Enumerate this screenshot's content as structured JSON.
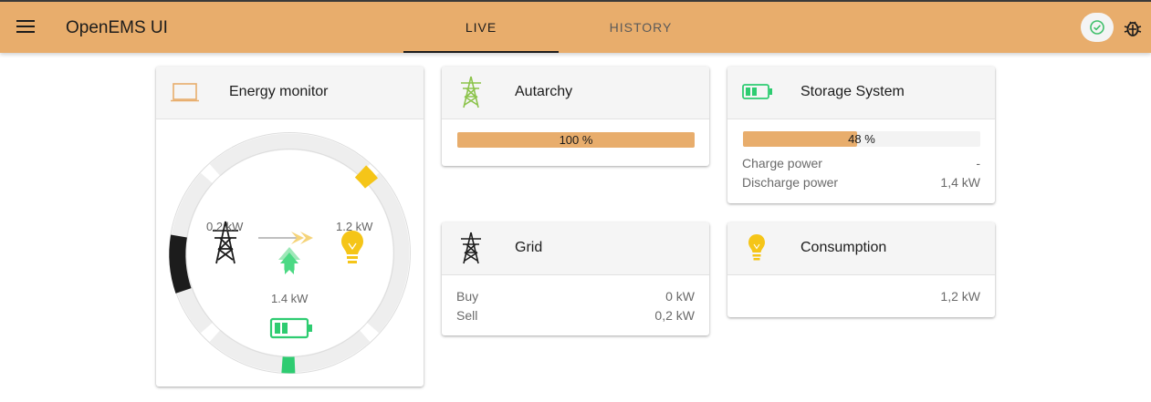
{
  "header": {
    "menu_icon": "menu-icon",
    "title": "OpenEMS UI",
    "tabs": [
      {
        "label": "LIVE",
        "active": true
      },
      {
        "label": "HISTORY",
        "active": false
      }
    ],
    "status_icon": "check-circle-icon",
    "bug_icon": "bug-icon",
    "accent_color": "#e8ad6c"
  },
  "energy_monitor": {
    "title": "Energy monitor",
    "icon": "laptop-icon",
    "grid_value": "0.2 kW",
    "consumption_value": "1.2 kW",
    "storage_value": "1.4 kW"
  },
  "autarchy": {
    "title": "Autarchy",
    "icon": "transmission-tower-icon",
    "percent": 100,
    "percent_label": "100 %"
  },
  "storage": {
    "title": "Storage System",
    "icon": "battery-icon",
    "percent": 48,
    "percent_label": "48 %",
    "rows": [
      {
        "label": "Charge power",
        "value": "-"
      },
      {
        "label": "Discharge power",
        "value": "1,4 kW"
      }
    ]
  },
  "grid": {
    "title": "Grid",
    "icon": "transmission-tower-icon",
    "rows": [
      {
        "label": "Buy",
        "value": "0 kW"
      },
      {
        "label": "Sell",
        "value": "0,2 kW"
      }
    ]
  },
  "consumption": {
    "title": "Consumption",
    "icon": "lightbulb-icon",
    "value": "1,2 kW"
  }
}
